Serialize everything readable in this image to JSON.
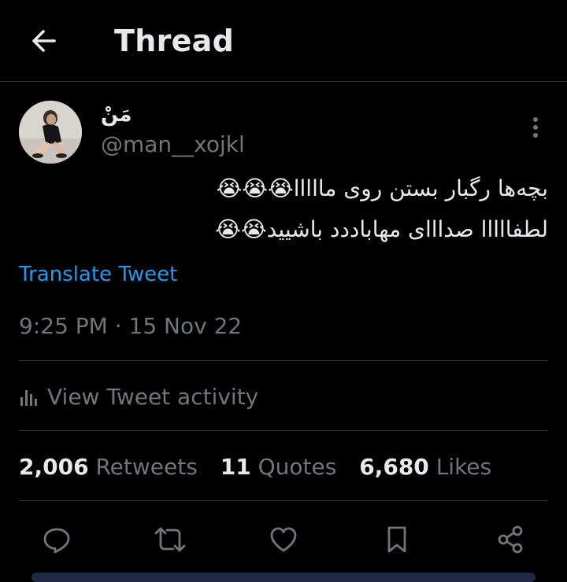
{
  "header": {
    "title": "Thread"
  },
  "tweet": {
    "display_name": "مَنْ",
    "handle": "@man__xojkl",
    "text_lines": [
      "بچه‌ها رگبار بستن روی مااااا😭😭😭",
      "لطفااااا صدااای مهاباددد باشیید😭😭"
    ],
    "translate_label": "Translate Tweet",
    "timestamp": "9:25 PM · 15 Nov 22",
    "activity_label": "View Tweet activity"
  },
  "stats": [
    {
      "value": "2,006",
      "label": "Retweets"
    },
    {
      "value": "11",
      "label": "Quotes"
    },
    {
      "value": "6,680",
      "label": "Likes"
    }
  ],
  "actions": {
    "icons": [
      "reply-icon",
      "retweet-icon",
      "like-icon",
      "bookmark-icon",
      "share-icon"
    ]
  },
  "colors": {
    "background": "#000000",
    "text_primary": "#e7e9ea",
    "text_secondary": "#71767b",
    "link": "#1d9bf0",
    "divider": "#2f3336"
  }
}
